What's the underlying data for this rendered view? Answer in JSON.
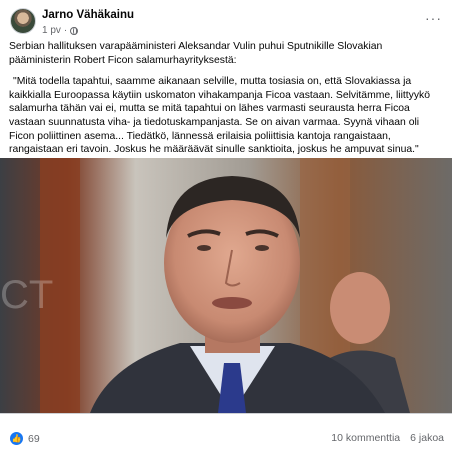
{
  "post": {
    "author": "Jarno Vähäkainu",
    "time": "1 pv",
    "time_separator": "·",
    "more_label": "···",
    "intro": "Serbian hallituksen varapääministeri Aleksandar Vulin puhui Sputnikille Slovakian pääministerin Robert Ficon salamurhayrityksestä:",
    "quote": "\"Mitä todella tapahtui, saamme aikanaan selville, mutta tosiasia on, että Slovakiassa ja kaikkialla Euroopassa käytiin uskomaton vihakampanja Ficoa vastaan.  Selvitämme, liittyykö salamurha tähän vai ei, mutta se mitä tapahtui on lähes varmasti seurausta herra Ficoa vastaan suunnatusta viha- ja tiedotuskampanjasta.  Se on aivan varmaa.  Syynä vihaan oli Ficon poliittinen asema... Tiedätkö, lännessä erilaisia poliittisia kantoja rangaistaan, rangaistaan eri tavoin.  Joskus he määräävät sinulle sanktioita, joskus he ampuvat sinua.\""
  },
  "photo": {
    "icon": "photo-of-man-in-suit"
  },
  "footer": {
    "reaction_icon": "like-icon",
    "reaction_count": "69",
    "comments": "10 kommenttia",
    "shares": "6 jakoa"
  },
  "colors": {
    "accent": "#1877f2",
    "secondary_text": "#65676b"
  }
}
